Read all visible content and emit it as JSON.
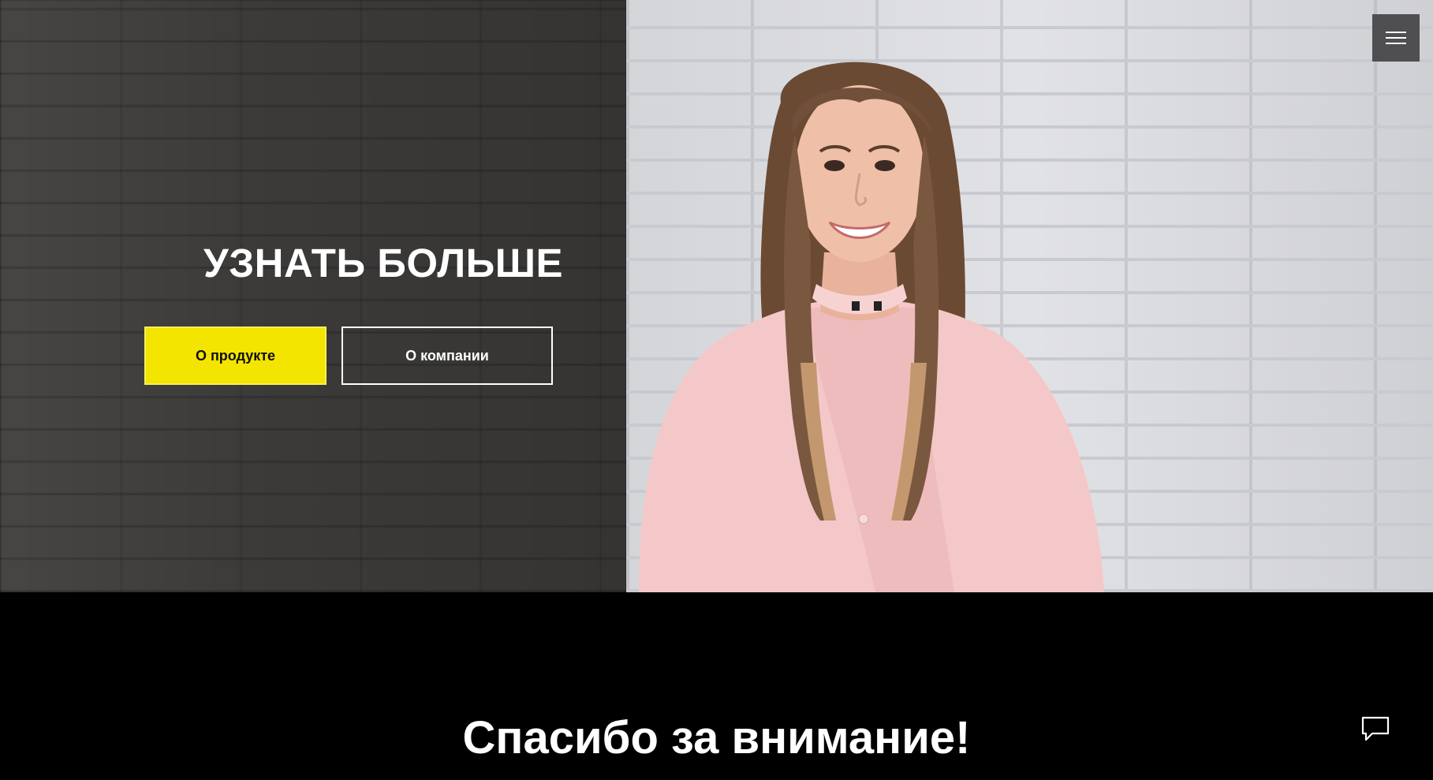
{
  "hero": {
    "title": "УЗНАТЬ БОЛЬШЕ",
    "buttons": {
      "product_label": "О продукте",
      "company_label": "О компании"
    },
    "menu_icon": "hamburger-menu-icon"
  },
  "footer_section": {
    "title": "Спасибо за внимание!",
    "chat_icon": "chat-bubble-icon"
  },
  "colors": {
    "accent": "#f3e500",
    "dark_background": "#000000",
    "menu_button": "#4f4f51"
  }
}
